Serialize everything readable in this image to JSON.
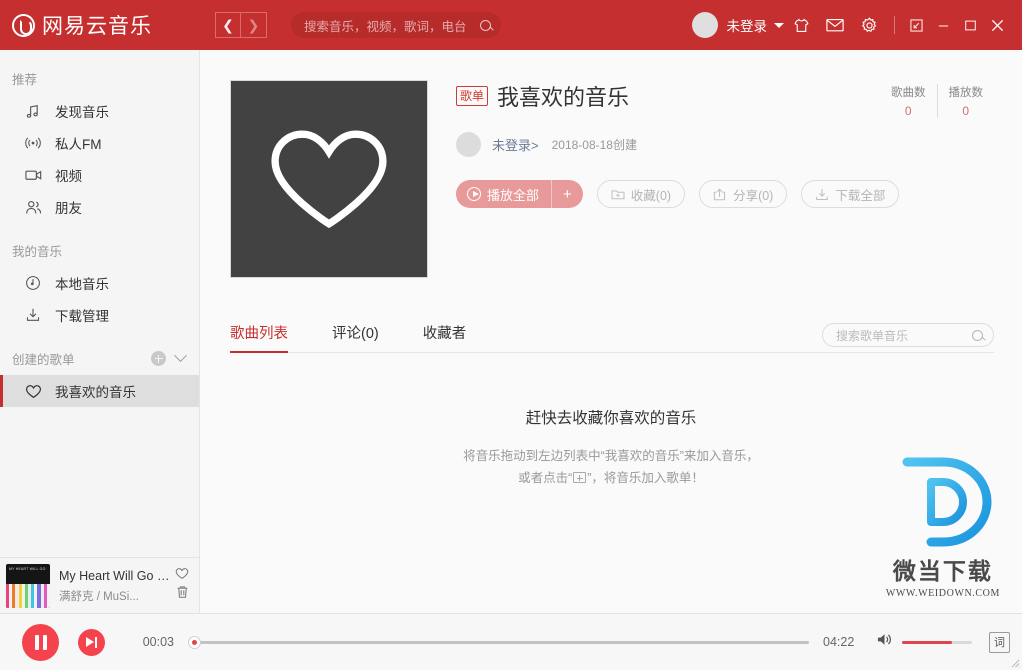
{
  "header": {
    "logo_text": "网易云音乐",
    "logo_icon": "netease-cloud-music-logo",
    "nav_back_icon": "chevron-left-icon",
    "nav_forward_icon": "chevron-right-icon",
    "search_placeholder": "搜索音乐，视频，歌词，电台",
    "search_value": "",
    "search_icon": "search-icon",
    "user_name": "未登录",
    "user_caret_icon": "chevron-down-icon",
    "skin_icon": "tshirt-skin-icon",
    "mail_icon": "mail-icon",
    "settings_icon": "gear-icon",
    "restore_icon": "restore-down-icon",
    "minimize_icon": "minimize-icon",
    "maximize_icon": "maximize-icon",
    "close_icon": "close-icon"
  },
  "sidebar": {
    "groups": [
      {
        "title": "推荐",
        "has_actions": false,
        "items": [
          {
            "label": "发现音乐",
            "icon": "music-note-icon",
            "active": false
          },
          {
            "label": "私人FM",
            "icon": "radio-fm-icon",
            "active": false
          },
          {
            "label": "视频",
            "icon": "video-camera-icon",
            "active": false
          },
          {
            "label": "朋友",
            "icon": "friends-icon",
            "active": false
          }
        ]
      },
      {
        "title": "我的音乐",
        "has_actions": false,
        "items": [
          {
            "label": "本地音乐",
            "icon": "disc-clock-icon",
            "active": false
          },
          {
            "label": "下载管理",
            "icon": "download-icon",
            "active": false
          }
        ]
      },
      {
        "title": "创建的歌单",
        "has_actions": true,
        "add_icon": "plus-circle-icon",
        "collapse_icon": "chevron-down-icon",
        "items": [
          {
            "label": "我喜欢的音乐",
            "icon": "heart-icon",
            "active": true
          }
        ]
      }
    ]
  },
  "now_playing": {
    "title": "My Heart Will Go On",
    "artist": "满舒克 / MuSi...",
    "cover_caption": "MY HEART WILL GO ON",
    "like_icon": "heart-outline-icon",
    "delete_icon": "trash-icon"
  },
  "playlist": {
    "cover_icon": "heart-outline-icon",
    "badge": "歌单",
    "title": "我喜欢的音乐",
    "creator": "未登录>",
    "created_date": "2018-08-18创建",
    "stats": [
      {
        "label": "歌曲数",
        "value": "0"
      },
      {
        "label": "播放数",
        "value": "0"
      }
    ],
    "buttons": {
      "play_all": "播放全部",
      "play_icon": "play-circle-icon",
      "add_label": "+",
      "collect": "收藏(0)",
      "collect_icon": "folder-plus-icon",
      "share": "分享(0)",
      "share_icon": "share-icon",
      "download": "下载全部",
      "download_icon": "download-icon"
    }
  },
  "tabs": {
    "items": [
      {
        "label": "歌曲列表",
        "active": true
      },
      {
        "label": "评论(0)",
        "active": false
      },
      {
        "label": "收藏者",
        "active": false
      }
    ],
    "search_placeholder": "搜索歌单音乐",
    "search_value": "",
    "search_icon": "search-icon"
  },
  "empty_state": {
    "heading": "赶快去收藏你喜欢的音乐",
    "line1": "将音乐拖动到左边列表中“我喜欢的音乐”来加入音乐，",
    "line2_before": "或者点击“",
    "line2_after": "”，将音乐加入歌单！",
    "inline_icon": "add-to-playlist-icon"
  },
  "watermark": {
    "logo_letter": "D",
    "cn_text": "微当下载",
    "url_text": "WWW.WEIDOWN.COM",
    "color": "#28a8e8"
  },
  "player": {
    "pause_icon": "pause-icon",
    "next_icon": "next-track-icon",
    "current_time": "00:03",
    "total_time": "04:22",
    "progress_percent": 0,
    "volume_icon": "volume-icon",
    "volume_percent": 71,
    "lyric_label": "词"
  },
  "colors": {
    "brand_red": "#c62f2f",
    "player_red": "#f5434e",
    "accent_red": "#e0444f",
    "sidebar_bg": "#f5f5f5",
    "main_bg": "#fafafa"
  }
}
